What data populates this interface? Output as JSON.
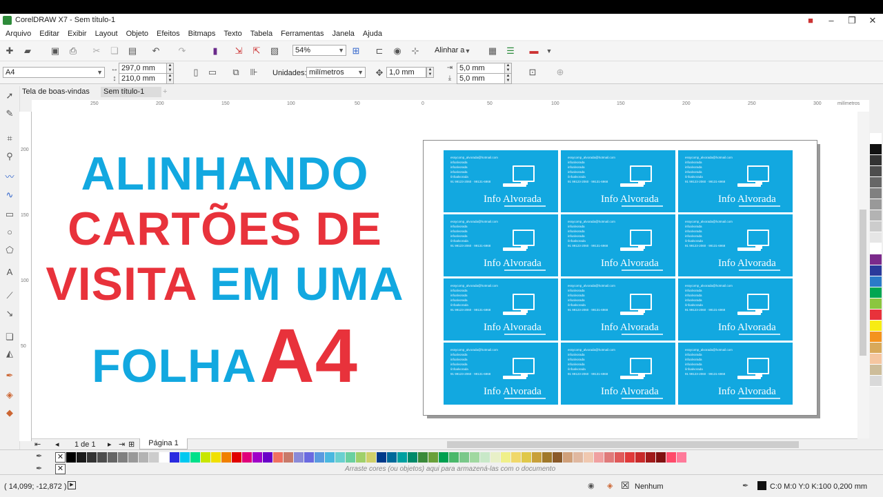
{
  "app": {
    "window_title": "CorelDRAW X7 - Sem título-1"
  },
  "menu": [
    "Arquivo",
    "Editar",
    "Exibir",
    "Layout",
    "Objeto",
    "Efeitos",
    "Bitmaps",
    "Texto",
    "Tabela",
    "Ferramentas",
    "Janela",
    "Ajuda"
  ],
  "toolbar": {
    "zoom_value": "54%",
    "align_label": "Alinhar a"
  },
  "property_bar": {
    "page_size": "A4",
    "width": "297,0 mm",
    "height": "210,0 mm",
    "units_label": "Unidades:",
    "units_value": "milímetros",
    "nudge": "1,0 mm",
    "dup_x": "5,0 mm",
    "dup_y": "5,0 mm"
  },
  "doc_tabs": [
    "Tela de boas-vindas",
    "Sem título-1"
  ],
  "ruler": {
    "h_ticks": [
      "250",
      "200",
      "150",
      "100",
      "50",
      "0",
      "50",
      "100",
      "150",
      "200",
      "250",
      "300"
    ],
    "unit": "milímetros",
    "v_ticks": [
      "200",
      "150",
      "100",
      "50"
    ]
  },
  "headline": {
    "line1": "ALINHANDO",
    "line2": "CARTÕES DE",
    "line3a": "VISITA",
    "line3b": "EM UMA",
    "line4a": "FOLHA",
    "line4b": "A4"
  },
  "card": {
    "email": "essycomp_alvorada@hotmail.com",
    "line2": "infoalvorada",
    "line3": "infoalvorada",
    "line4": "infoalvorada",
    "line5": "/infoalvorada",
    "phones": "91 99123-2060 · 99131-6968",
    "name": "Info Alvorada"
  },
  "page_nav": {
    "page_count": "1 de 1",
    "page_tab": "Página 1"
  },
  "palette_hint": "Arraste cores (ou objetos) aqui para armazená-las com o documento",
  "status": {
    "coords": "( 14,099; -12,872 )",
    "fill": "Nenhum",
    "outline": "C:0 M:0 Y:0 K:100  0,200 mm"
  },
  "colors": {
    "accent_blue": "#12a8e0",
    "accent_red": "#e8323b"
  }
}
